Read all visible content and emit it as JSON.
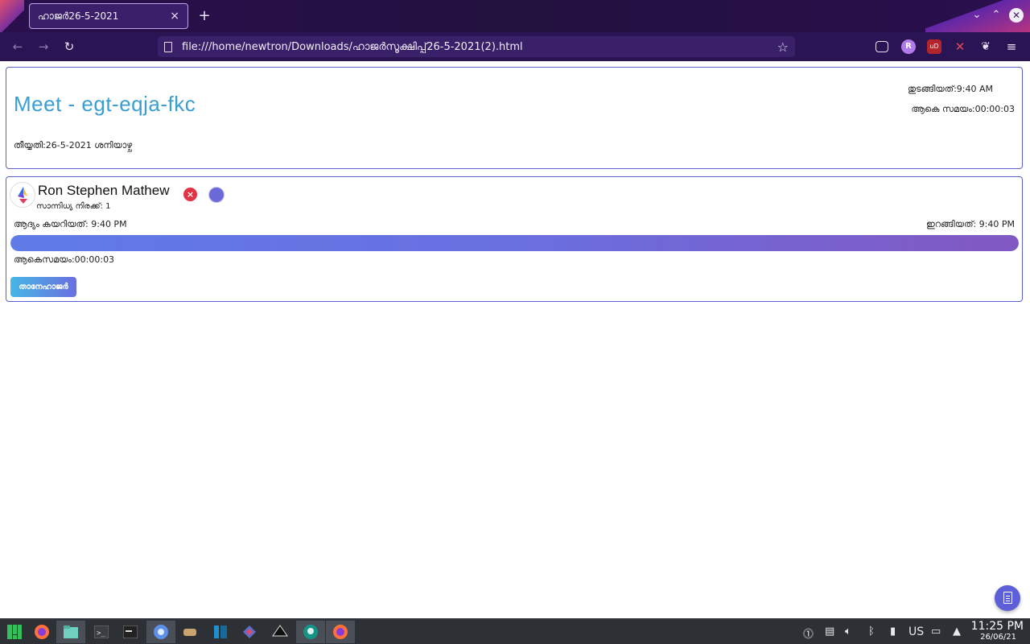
{
  "browser": {
    "tab_title": "ഹാജർ26-5-2021",
    "tab_close": "×",
    "new_tab": "+",
    "url": "file:///home/newtron/Downloads/ഹാജർസൂക്ഷിപ്പ്26-5-2021(2).html",
    "extensions": [
      "pocket-icon",
      "profile-icon",
      "ublock-icon",
      "tools-icon",
      "squirrel-icon",
      "menu-icon"
    ],
    "profile_letter": "R",
    "ublock_label": "uD"
  },
  "meet": {
    "title": "Meet - egt-eqja-fkc",
    "date_line": "തീയ്യതി:26-5-2021 ശനിയാഴ്ച",
    "start_line": "തുടങ്ങിയത്:9:40 AM",
    "total_line": "ആകെ സമയം:00:00:03"
  },
  "participant": {
    "name": "Ron Stephen Mathew",
    "presence": "സാന്നിധ്യ നിരക്ക്: 1",
    "first_join": "ആദ്യം കയറിയത്: 9:40 PM",
    "last_leave": "ഇറങ്ങിയത്: 9:40 PM",
    "total": "ആകെസമയം:00:00:03",
    "progress": 1.0,
    "self_button": "താനേഹാജർ",
    "remove_symbol": "×"
  },
  "taskbar": {
    "apps": [
      "manjaro-icon",
      "firefox-icon",
      "files-icon",
      "terminal-icon",
      "terminal-alt-icon",
      "chromium-icon",
      "game-icon",
      "panel-icon",
      "kdeconnect-icon",
      "inkscape-icon",
      "gitkraken-icon",
      "firefox-active-icon"
    ],
    "keyboard_layout": "US",
    "time": "11:25 PM",
    "date": "26/06/21"
  },
  "colors": {
    "accent": "#3a9fd0",
    "border": "#5b5fd6",
    "remove": "#e23345",
    "chrome": "#2b1453"
  }
}
